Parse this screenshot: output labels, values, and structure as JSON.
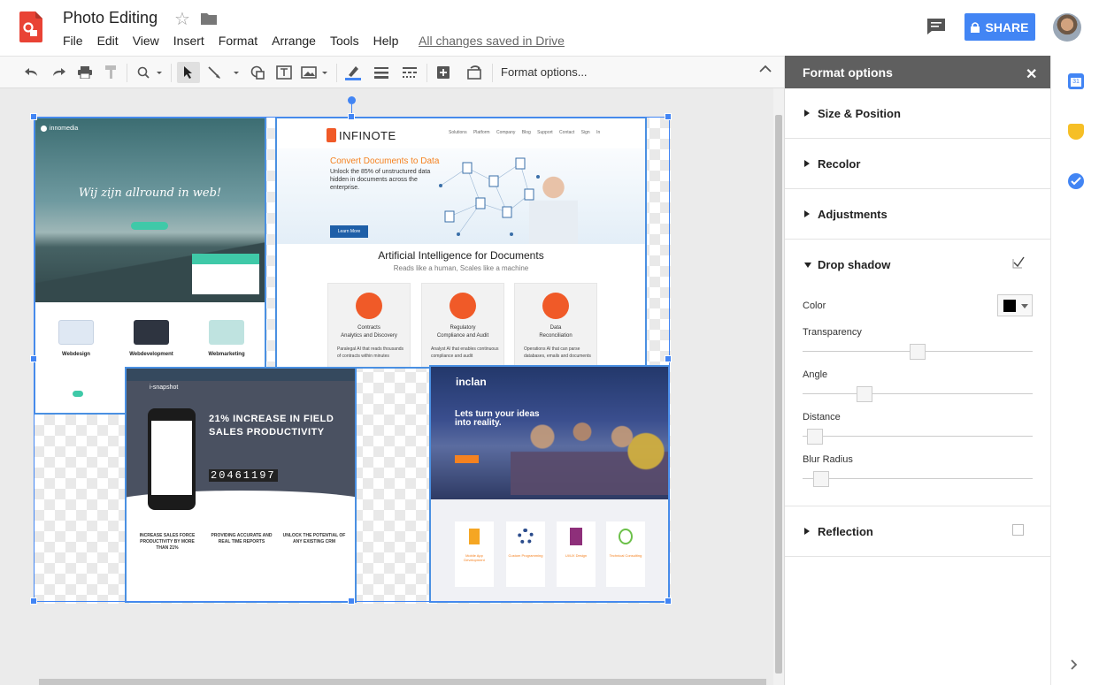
{
  "header": {
    "doc_title": "Photo Editing",
    "menu": [
      "File",
      "Edit",
      "View",
      "Insert",
      "Format",
      "Arrange",
      "Tools",
      "Help"
    ],
    "saved_status": "All changes saved in Drive",
    "share_label": "SHARE"
  },
  "toolbar": {
    "format_options_label": "Format options..."
  },
  "canvas": {
    "shot1": {
      "brand": "innomedia",
      "tagline": "Wij zijn allround in web!",
      "features": [
        "Webdesign",
        "Webdevelopment",
        "Webmarketing"
      ]
    },
    "shot2": {
      "logo": "INFINOTE",
      "nav": "Solutions Platform Company Blog Support Contact Sign In",
      "hero_title": "Convert Documents to Data",
      "hero_sub": "Unlock the 85% of unstructured data hidden in documents across the enterprise.",
      "cta": "Learn More",
      "section_title": "Artificial Intelligence for Documents",
      "section_sub": "Reads like a human, Scales like a machine",
      "cards": [
        {
          "title": "Contracts\nAnalytics and Discovery",
          "desc": "Paralegal AI that reads thousands of contracts within minutes"
        },
        {
          "title": "Regulatory\nCompliance and Audit",
          "desc": "Analyst AI that enables continuous compliance and audit"
        },
        {
          "title": "Data\nReconciliation",
          "desc": "Operations AI that can parse databases, emails and documents"
        }
      ]
    },
    "shot3": {
      "logo": "i-snapshot",
      "headline": "21% INCREASE IN FIELD SALES PRODUCTIVITY",
      "counter": "20461197",
      "columns": [
        "INCREASE SALES FORCE PRODUCTIVITY BY MORE THAN 21%",
        "PROVIDING ACCURATE AND REAL TIME REPORTS",
        "UNLOCK THE POTENTIAL OF ANY EXISTING CRM"
      ]
    },
    "shot4": {
      "logo": "inclan",
      "lead": "Lets turn your ideas into reality.",
      "tiles": [
        "Mobile App Development",
        "Custom Programming",
        "UI/UX Design",
        "Technical Consulting"
      ]
    }
  },
  "panel": {
    "title": "Format options",
    "sections": {
      "size_position": "Size & Position",
      "recolor": "Recolor",
      "adjustments": "Adjustments",
      "drop_shadow": "Drop shadow",
      "reflection": "Reflection"
    },
    "drop_shadow": {
      "enabled": true,
      "color_label": "Color",
      "color": "#000000",
      "transparency_label": "Transparency",
      "transparency": 0.5,
      "angle_label": "Angle",
      "angle": 0.25,
      "distance_label": "Distance",
      "distance": 0.02,
      "blur_label": "Blur Radius",
      "blur": 0.05
    },
    "reflection_enabled": false
  },
  "colors": {
    "accent": "#4285f4",
    "panel_header": "#5f5f5f",
    "logo_red": "#e94335"
  }
}
